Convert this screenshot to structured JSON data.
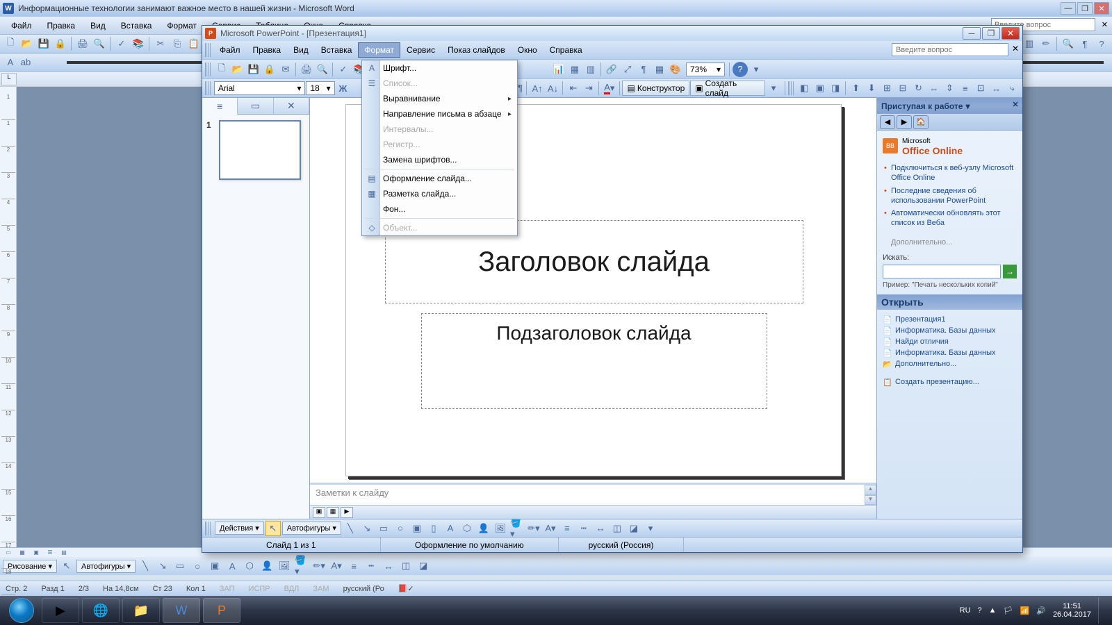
{
  "word": {
    "title": "Информационные технологии занимают важное место в нашей жизни - Microsoft Word",
    "helpPlaceholder": "Введите вопрос",
    "menu": {
      "file": "Файл",
      "edit": "Правка",
      "view": "Вид",
      "insert": "Вставка",
      "format": "Формат",
      "tools": "Сервис",
      "table": "Таблица",
      "window": "Окно",
      "help": "Справка"
    },
    "draw": {
      "actions": "Рисование",
      "autoshapes": "Автофигуры"
    },
    "ruler": [
      "1",
      "1",
      "2",
      "3",
      "4",
      "5",
      "6",
      "7",
      "8",
      "9",
      "10",
      "11",
      "12",
      "13",
      "14",
      "15",
      "16",
      "17",
      "18"
    ],
    "status": {
      "page": "Стр. 2",
      "section": "Разд 1",
      "pages": "2/3",
      "at": "На 14,8см",
      "line": "Ст 23",
      "col": "Кол 1",
      "zap": "ЗАП",
      "ispr": "ИСПР",
      "vdl": "ВДЛ",
      "zam": "ЗАМ",
      "lang": "русский (Ро"
    }
  },
  "pp": {
    "title": "Microsoft PowerPoint - [Презентация1]",
    "helpPlaceholder": "Введите вопрос",
    "menu": {
      "file": "Файл",
      "edit": "Правка",
      "view": "Вид",
      "insert": "Вставка",
      "format": "Формат",
      "tools": "Сервис",
      "slideshow": "Показ слайдов",
      "window": "Окно",
      "help": "Справка"
    },
    "font": "Arial",
    "fontSize": "18",
    "zoom": "73%",
    "thumb1": "1",
    "designer": "Конструктор",
    "newSlide": "Создать слайд",
    "slide": {
      "title": "Заголовок слайда",
      "subtitle": "Подзаголовок слайда"
    },
    "notes": "Заметки к слайду",
    "draw": {
      "actions": "Действия",
      "autoshapes": "Автофигуры"
    },
    "status": {
      "left": "Слайд 1 из 1",
      "mid": "Оформление по умолчанию",
      "right": "русский (Россия)"
    },
    "formatMenu": {
      "font": "Шрифт...",
      "list": "Список...",
      "align": "Выравнивание",
      "dir": "Направление письма в абзаце",
      "intervals": "Интервалы...",
      "register": "Регистр...",
      "replaceFonts": "Замена шрифтов...",
      "design": "Оформление слайда...",
      "layout": "Разметка слайда...",
      "bg": "Фон...",
      "object": "Объект..."
    },
    "task": {
      "header": "Приступая к работе",
      "officeOnline": "Office Online",
      "officePrefix": "Microsoft",
      "links": [
        "Подключиться к веб-узлу Microsoft Office Online",
        "Последние сведения об использовании PowerPoint",
        "Автоматически обновлять этот список из Веба"
      ],
      "more": "Дополнительно...",
      "searchLabel": "Искать:",
      "example": "Пример:  \"Печать нескольких копий\"",
      "openHeader": "Открыть",
      "files": [
        "Презентация1",
        "Информатика. Базы данных",
        "Найди отличия",
        "Информатика. Базы данных"
      ],
      "moreFiles": "Дополнительно...",
      "create": "Создать презентацию..."
    }
  },
  "taskbar": {
    "lang": "RU",
    "time": "11:51",
    "date": "26.04.2017"
  }
}
